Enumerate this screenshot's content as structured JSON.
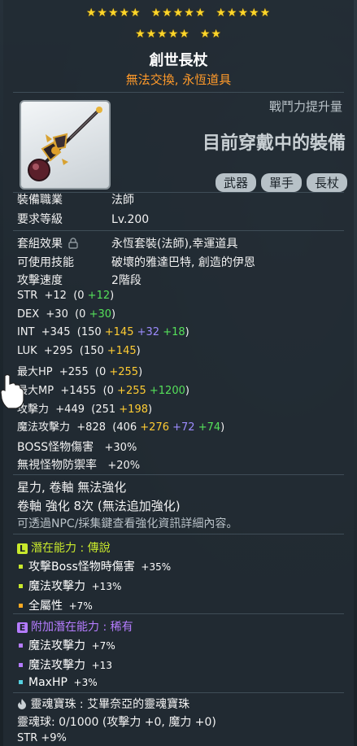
{
  "stars": {
    "row1": [
      "★★★★★",
      "★★★★★",
      "★★★★★"
    ],
    "row2": [
      "★★★★★",
      "★★"
    ]
  },
  "item": {
    "name": "創世長杖",
    "trade": "無法交換, 永恆道具"
  },
  "header": {
    "power_label": "戰鬥力提升量",
    "equipped_label": "目前穿戴中的裝備",
    "tags": [
      "武器",
      "單手",
      "長杖"
    ]
  },
  "basic": [
    {
      "label": "裝備職業",
      "value": "法師"
    },
    {
      "label": "要求等級",
      "value": "Lv.200"
    }
  ],
  "set": {
    "label": "套組效果",
    "value": "永恆套裝(法師),幸運道具"
  },
  "skills": {
    "label": "可使用技能",
    "value": "破壞的雅達巴特, 創造的伊恩"
  },
  "speed": {
    "label": "攻擊速度",
    "value": "2階段"
  },
  "stats": [
    {
      "name": "STR",
      "total": "+12",
      "open": "(0",
      "parts": [
        {
          "v": "+12",
          "c": "g"
        }
      ],
      "close": ")"
    },
    {
      "name": "DEX",
      "total": "+30",
      "open": "(0",
      "parts": [
        {
          "v": "+30",
          "c": "g"
        }
      ],
      "close": ")"
    },
    {
      "name": "INT",
      "total": "+345",
      "open": "(150",
      "parts": [
        {
          "v": "+145",
          "c": "y"
        },
        {
          "v": "+32",
          "c": "p"
        },
        {
          "v": "+18",
          "c": "g"
        }
      ],
      "close": ")"
    },
    {
      "name": "LUK",
      "total": "+295",
      "open": "(150",
      "parts": [
        {
          "v": "+145",
          "c": "y"
        }
      ],
      "close": ")"
    },
    {
      "name": "最大HP",
      "total": "+255",
      "open": "(0",
      "parts": [
        {
          "v": "+255",
          "c": "y"
        }
      ],
      "close": ")"
    },
    {
      "name": "最大MP",
      "total": "+1455",
      "open": "(0",
      "parts": [
        {
          "v": "+255",
          "c": "y"
        },
        {
          "v": "+1200",
          "c": "g"
        }
      ],
      "close": ")"
    },
    {
      "name": "攻擊力",
      "total": "+449",
      "open": "(251",
      "parts": [
        {
          "v": "+198",
          "c": "y"
        }
      ],
      "close": ")"
    },
    {
      "name": "魔法攻擊力",
      "total": "+828",
      "open": "(406",
      "parts": [
        {
          "v": "+276",
          "c": "y"
        },
        {
          "v": "+72",
          "c": "p"
        },
        {
          "v": "+74",
          "c": "g"
        }
      ],
      "close": ")"
    }
  ],
  "extra": [
    {
      "name": "BOSS怪物傷害",
      "value": "+30%"
    },
    {
      "name": "無視怪物防禦率",
      "value": "+20%"
    }
  ],
  "upgrade": {
    "line1": "星力, 卷軸 無法強化",
    "line2": "卷軸 強化 8次 (無法追加強化)",
    "line3": "可透過NPC/採集鍵查看強化資訊詳細內容。"
  },
  "potential": {
    "badge": "L",
    "title": "潛在能力",
    "rank": "傳說",
    "color": "#c8e82c",
    "lines": [
      {
        "text": "攻擊Boss怪物時傷害",
        "value": "+35%",
        "dot": "#c8e82c"
      },
      {
        "text": "魔法攻擊力",
        "value": "+13%",
        "dot": "#c8e82c"
      },
      {
        "text": "全屬性",
        "value": "+7%",
        "dot": "#ffaa22"
      }
    ]
  },
  "additional": {
    "badge": "E",
    "title": "附加潛在能力",
    "rank": "稀有",
    "color": "#b57cff",
    "lines": [
      {
        "text": "魔法攻擊力",
        "value": "+7%",
        "dot": "#b57cff"
      },
      {
        "text": "魔法攻擊力",
        "value": "+13",
        "dot": "#b57cff"
      },
      {
        "text": "MaxHP",
        "value": "+3%",
        "dot": "#55d0e0"
      }
    ]
  },
  "soul": {
    "label": "靈魂寶珠",
    "name": "艾畢奈亞的靈魂寶珠",
    "line2": "靈魂球: 0/1000 (攻擊力 +0, 魔力 +0)",
    "line3": "STR +9%"
  }
}
